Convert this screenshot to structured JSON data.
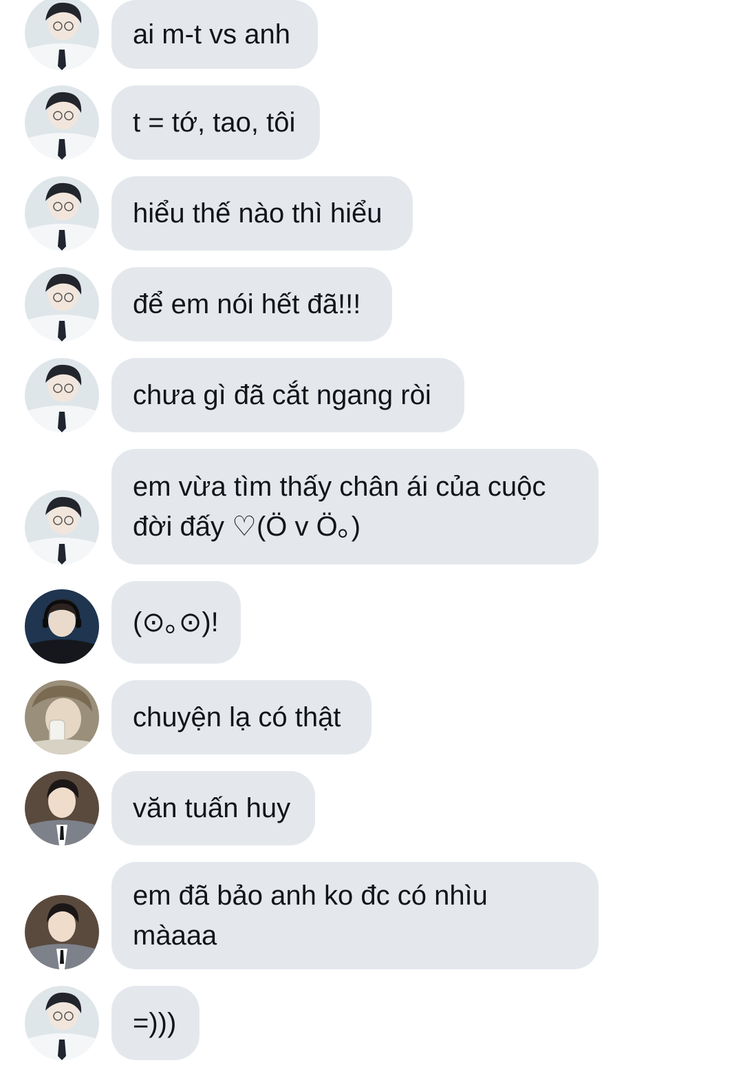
{
  "conversation": {
    "messages": [
      {
        "sender": "avatar-a",
        "text": "ai m-t vs anh"
      },
      {
        "sender": "avatar-a",
        "text": "t = tớ, tao, tôi"
      },
      {
        "sender": "avatar-a",
        "text": "hiểu thế nào thì hiểu"
      },
      {
        "sender": "avatar-a",
        "text": "để em nói hết đã!!!"
      },
      {
        "sender": "avatar-a",
        "text": "chưa gì đã cắt ngang ròi"
      },
      {
        "sender": "avatar-a",
        "text": "em vừa tìm thấy chân ái của cuộc\nđời đấy ♡(Ö v Ö｡)"
      },
      {
        "sender": "avatar-b",
        "text": "(⊙｡⊙)!"
      },
      {
        "sender": "avatar-c",
        "text": "chuyện lạ có thật"
      },
      {
        "sender": "avatar-d",
        "text": "văn tuấn huy"
      },
      {
        "sender": "avatar-d",
        "text": "em đã bảo anh ko đc có nhìu\nmàaaa"
      },
      {
        "sender": "avatar-a",
        "text": "=)))"
      }
    ]
  },
  "colors": {
    "bubble_background": "#e4e8ed",
    "text": "#111418",
    "page_background": "#ffffff"
  }
}
